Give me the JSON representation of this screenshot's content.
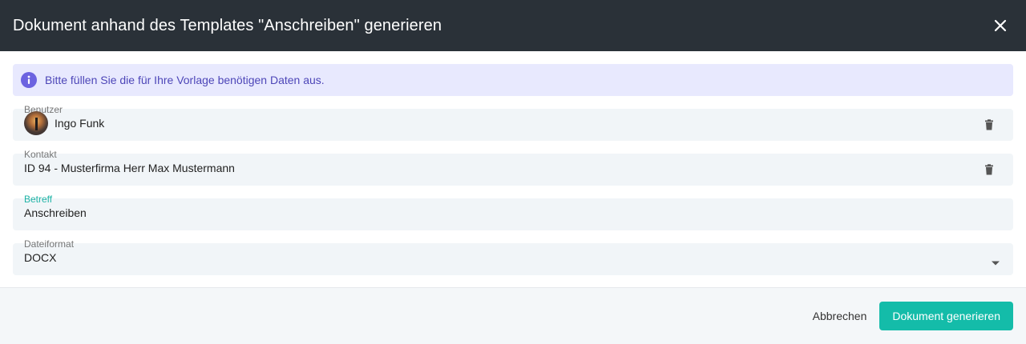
{
  "header": {
    "title": "Dokument anhand des Templates \"Anschreiben\" generieren"
  },
  "info": {
    "text": "Bitte füllen Sie die für Ihre Vorlage benötigen Daten aus."
  },
  "fields": {
    "user": {
      "label": "Benutzer",
      "value": "Ingo Funk"
    },
    "contact": {
      "label": "Kontakt",
      "value": "ID 94 - Musterfirma Herr Max Mustermann"
    },
    "subject": {
      "label": "Betreff",
      "value": "Anschreiben"
    },
    "format": {
      "label": "Dateiformat",
      "value": "DOCX"
    }
  },
  "footer": {
    "cancel_label": "Abbrechen",
    "submit_label": "Dokument generieren"
  },
  "icons": {
    "close": "close-icon",
    "info": "info-icon",
    "trash": "trash-icon",
    "dropdown": "caret-down-icon"
  },
  "colors": {
    "header_bg": "#2a3138",
    "accent": "#14bca9",
    "info_bg": "#e8e9fe",
    "info_text": "#4d46b8"
  }
}
